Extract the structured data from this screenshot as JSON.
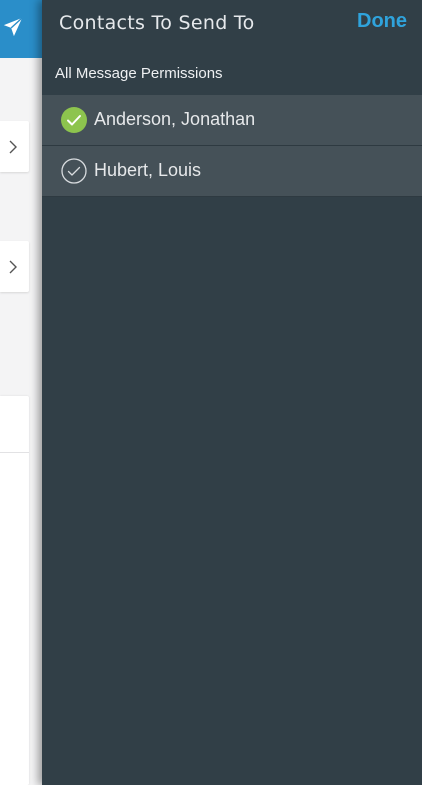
{
  "drawer": {
    "title": "Contacts To Send To",
    "done_label": "Done",
    "section_label": "All Message Permissions",
    "contacts": [
      {
        "name": "Anderson, Jonathan",
        "selected": true
      },
      {
        "name": "Hubert, Louis",
        "selected": false
      }
    ]
  },
  "colors": {
    "drawer_bg": "#313f47",
    "row_bg": "#455158",
    "accent": "#2fa3dc",
    "selected_check": "#8dc44e",
    "header_blue": "#2a8ec9"
  },
  "icons": {
    "background_header": "send-icon",
    "background_cards": "chevron-right-icon",
    "selected": "check-circle-filled-icon",
    "unselected": "check-circle-outline-icon"
  }
}
